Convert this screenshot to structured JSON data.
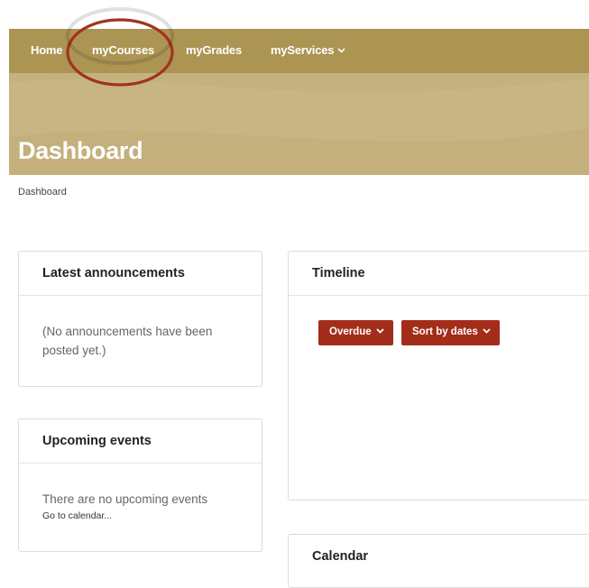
{
  "nav": {
    "items": [
      {
        "label": "Home"
      },
      {
        "label": "myCourses"
      },
      {
        "label": "myGrades"
      },
      {
        "label": "myServices"
      }
    ]
  },
  "page": {
    "title": "Dashboard"
  },
  "breadcrumb": {
    "label": "Dashboard"
  },
  "announcements": {
    "title": "Latest announcements",
    "empty_line1": "(No announcements have been",
    "empty_line2": "posted yet.)"
  },
  "events": {
    "title": "Upcoming events",
    "empty": "There are no upcoming events",
    "calendar_link": "Go to calendar..."
  },
  "timeline": {
    "title": "Timeline",
    "filter_label": "Overdue",
    "sort_label": "Sort by dates"
  },
  "calendar": {
    "title": "Calendar"
  },
  "colors": {
    "nav": "#ac9453",
    "band": "#c4b17e",
    "button": "#a32d1a",
    "highlight": "#a3321f"
  }
}
